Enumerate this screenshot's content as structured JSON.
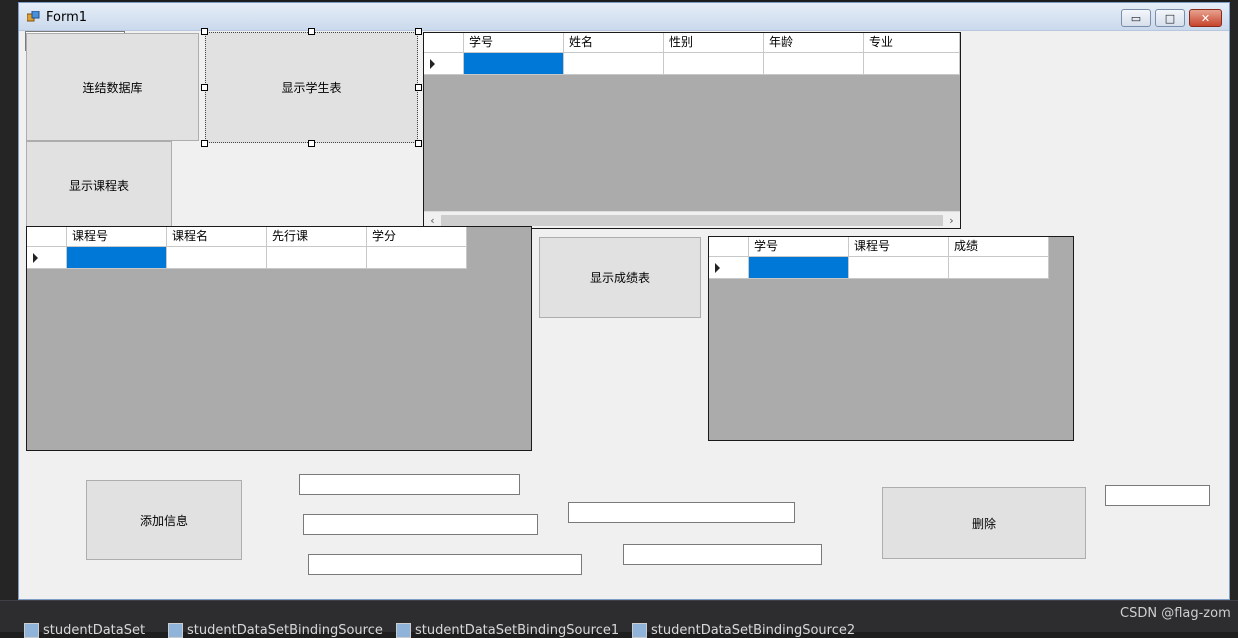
{
  "window": {
    "title": "Form1",
    "minimize_glyph": "▭",
    "maximize_glyph": "□",
    "close_glyph": "✕"
  },
  "buttons": {
    "connect_db": "连结数据库",
    "show_students": "显示学生表",
    "show_courses": "显示课程表",
    "show_grades": "显示成绩表",
    "add_info": "添加信息",
    "delete": "删除"
  },
  "student_grid": {
    "columns": [
      "学号",
      "姓名",
      "性别",
      "年龄",
      "专业"
    ]
  },
  "course_grid": {
    "columns": [
      "课程号",
      "课程名",
      "先行课",
      "学分"
    ]
  },
  "grade_grid": {
    "columns": [
      "学号",
      "课程号",
      "成绩"
    ]
  },
  "textboxes": {
    "top_left": "",
    "add_1": "",
    "add_2": "",
    "add_3": "",
    "mid_1": "",
    "mid_2": "",
    "delete_key": ""
  },
  "tray": {
    "items": [
      "studentDataSet",
      "studentDataSetBindingSource",
      "studentDataSetBindingSource1",
      "studentDataSetBindingSource2"
    ]
  },
  "watermark": "CSDN @flag-zom",
  "colors": {
    "selection": "#0078d7",
    "grid_background": "#ababab",
    "form_background": "#f0f0f0"
  }
}
